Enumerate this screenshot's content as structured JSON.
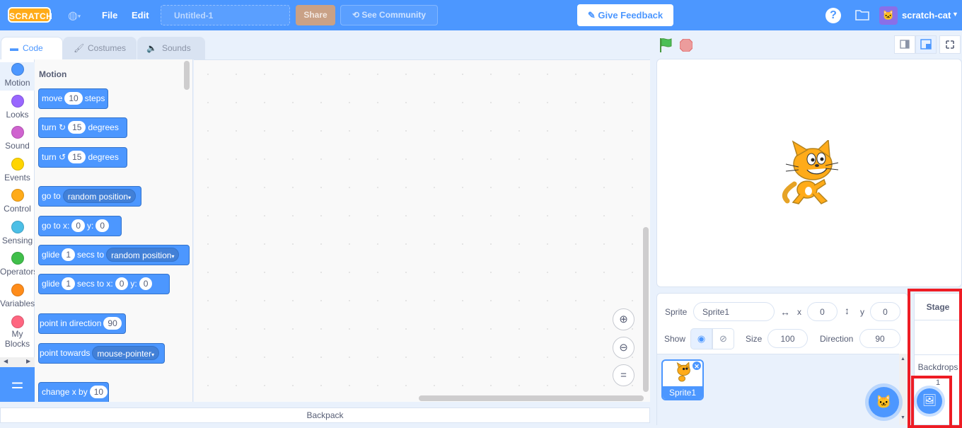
{
  "menubar": {
    "logo": "SCRATCH",
    "file": "File",
    "edit": "Edit",
    "project_title": "Untitled-1",
    "share": "Share",
    "see_community": "See Community",
    "give_feedback": "Give Feedback",
    "help": "?",
    "username": "scratch-cat"
  },
  "tabs": {
    "code": "Code",
    "costumes": "Costumes",
    "sounds": "Sounds"
  },
  "categories": [
    {
      "label": "Motion",
      "color": "#4c97ff"
    },
    {
      "label": "Looks",
      "color": "#9966ff"
    },
    {
      "label": "Sound",
      "color": "#cf63cf"
    },
    {
      "label": "Events",
      "color": "#ffd500"
    },
    {
      "label": "Control",
      "color": "#ffab19"
    },
    {
      "label": "Sensing",
      "color": "#4cbfe6"
    },
    {
      "label": "Operators",
      "color": "#40bf4a"
    },
    {
      "label": "Variables",
      "color": "#ff8c1a"
    },
    {
      "label": "My Blocks",
      "color": "#ff6680"
    }
  ],
  "palette": {
    "section": "Motion",
    "blocks": {
      "move": {
        "a": "move",
        "v": "10",
        "b": "steps"
      },
      "turn_right": {
        "a": "turn",
        "v": "15",
        "b": "degrees"
      },
      "turn_left": {
        "a": "turn",
        "v": "15",
        "b": "degrees"
      },
      "goto": {
        "a": "go to",
        "d": "random position"
      },
      "goto_xy": {
        "a": "go to x:",
        "x": "0",
        "b": "y:",
        "y": "0"
      },
      "glide_to": {
        "a": "glide",
        "v": "1",
        "b": "secs to",
        "d": "random position"
      },
      "glide_xy": {
        "a": "glide",
        "v": "1",
        "b": "secs to x:",
        "x": "0",
        "c": "y:",
        "y": "0"
      },
      "point_dir": {
        "a": "point in direction",
        "v": "90"
      },
      "point_towards": {
        "a": "point towards",
        "d": "mouse-pointer"
      },
      "change_x": {
        "a": "change x by",
        "v": "10"
      }
    }
  },
  "backpack": "Backpack",
  "sprite_info": {
    "sprite_label": "Sprite",
    "sprite_name": "Sprite1",
    "x_label": "x",
    "x_value": "0",
    "y_label": "y",
    "y_value": "0",
    "show_label": "Show",
    "size_label": "Size",
    "size_value": "100",
    "direction_label": "Direction",
    "direction_value": "90"
  },
  "sprites": [
    {
      "name": "Sprite1"
    }
  ],
  "stage_target": {
    "label": "Stage",
    "backdrops_label": "Backdrops",
    "backdrops_count": "1"
  },
  "colors": {
    "accent": "#4c97ff",
    "highlight": "#ee1c24",
    "feedback_bg": "#ffffff"
  }
}
